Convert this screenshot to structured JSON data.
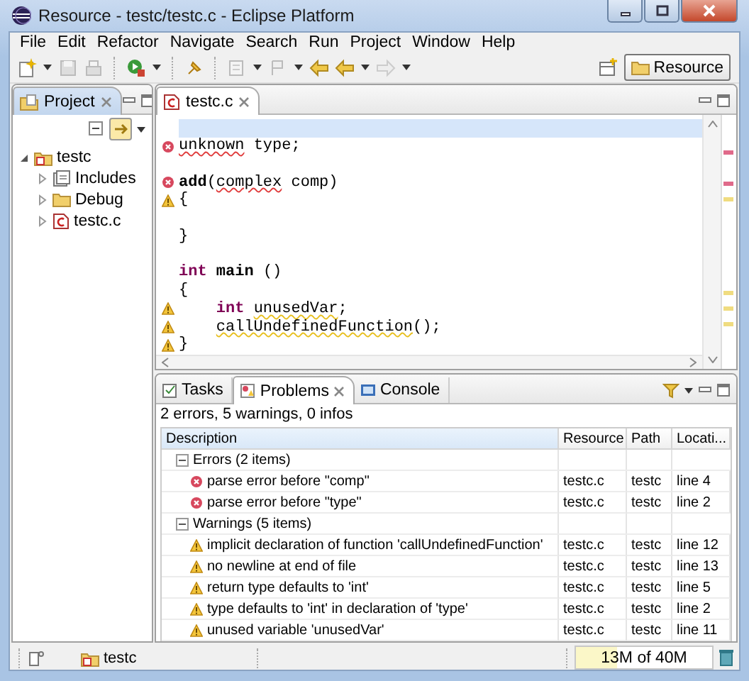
{
  "window": {
    "title": "Resource - testc/testc.c - Eclipse Platform"
  },
  "menu": [
    "File",
    "Edit",
    "Refactor",
    "Navigate",
    "Search",
    "Run",
    "Project",
    "Window",
    "Help"
  ],
  "perspective": {
    "label": "Resource",
    "selected": true
  },
  "project_view": {
    "title": "Project",
    "tree": [
      {
        "label": "testc",
        "kind": "project",
        "expanded": true,
        "children": [
          {
            "label": "Includes",
            "kind": "includes",
            "expanded": false
          },
          {
            "label": "Debug",
            "kind": "folder",
            "expanded": false
          },
          {
            "label": "testc.c",
            "kind": "file",
            "expanded": false
          }
        ]
      }
    ]
  },
  "editor": {
    "tab": "testc.c",
    "lines": [
      {
        "current": true
      },
      {
        "kind": "error",
        "current": false,
        "segments": [
          {
            "text": "unknown",
            "kind": "error"
          },
          {
            "text": " type;",
            "kind": "plain"
          }
        ]
      },
      {
        "current": false
      },
      {
        "kind": "error",
        "current": false,
        "segments": [
          {
            "text": "add",
            "kind": "function"
          },
          {
            "text": "(",
            "kind": "plain"
          },
          {
            "text": "complex",
            "kind": "error"
          },
          {
            "text": " comp)",
            "kind": "plain"
          }
        ]
      },
      {
        "kind": "warning",
        "current": false,
        "segments": [
          {
            "text": "{",
            "kind": "plain"
          }
        ]
      },
      {
        "current": false
      },
      {
        "current": false,
        "segments": [
          {
            "text": "}",
            "kind": "plain"
          }
        ]
      },
      {
        "current": false
      },
      {
        "current": false,
        "segments": [
          {
            "text": "int",
            "kind": "keyword"
          },
          {
            "text": " main",
            "kind": "function"
          },
          {
            "text": " ()",
            "kind": "plain"
          }
        ]
      },
      {
        "current": false,
        "segments": [
          {
            "text": "{",
            "kind": "plain"
          }
        ]
      },
      {
        "kind": "warning",
        "current": false,
        "segments": [
          {
            "text": "    int",
            "kind": "keyword"
          },
          {
            "text": " unusedVar",
            "kind": "warning"
          },
          {
            "text": ";",
            "kind": "plain"
          }
        ]
      },
      {
        "kind": "warning",
        "current": false,
        "segments": [
          {
            "text": "    callUndefinedFunction",
            "kind": "warning"
          },
          {
            "text": "();",
            "kind": "plain"
          }
        ]
      },
      {
        "kind": "warning",
        "current": false,
        "segments": [
          {
            "text": "}",
            "kind": "plain"
          }
        ]
      }
    ]
  },
  "problems_view": {
    "tabs": [
      {
        "label": "Tasks",
        "selected": false
      },
      {
        "label": "Problems",
        "selected": true
      },
      {
        "label": "Console",
        "selected": false
      }
    ],
    "summary": "2 errors, 5 warnings, 0 infos",
    "columns": [
      "Description",
      "Resource",
      "Path",
      "Locati..."
    ],
    "groups": [
      {
        "label": "Errors (2 items)",
        "kind": "error",
        "expanded": true,
        "children": [
          {
            "description": "parse error before \"comp\"",
            "resource": "testc.c",
            "path": "testc",
            "location": "line 4"
          },
          {
            "description": "parse error before \"type\"",
            "resource": "testc.c",
            "path": "testc",
            "location": "line 2"
          }
        ]
      },
      {
        "label": "Warnings (5 items)",
        "kind": "warning",
        "expanded": true,
        "children": [
          {
            "description": "implicit declaration of function 'callUndefinedFunction'",
            "resource": "testc.c",
            "path": "testc",
            "location": "line 12"
          },
          {
            "description": "no newline at end of file",
            "resource": "testc.c",
            "path": "testc",
            "location": "line 13"
          },
          {
            "description": "return type defaults to 'int'",
            "resource": "testc.c",
            "path": "testc",
            "location": "line 5"
          },
          {
            "description": "type defaults to 'int' in declaration of 'type'",
            "resource": "testc.c",
            "path": "testc",
            "location": "line 2"
          },
          {
            "description": "unused variable 'unusedVar'",
            "resource": "testc.c",
            "path": "testc",
            "location": "line 11"
          }
        ]
      }
    ]
  },
  "status_bar": {
    "project": "testc",
    "memory": "13M of 40M",
    "level": 0.3
  }
}
